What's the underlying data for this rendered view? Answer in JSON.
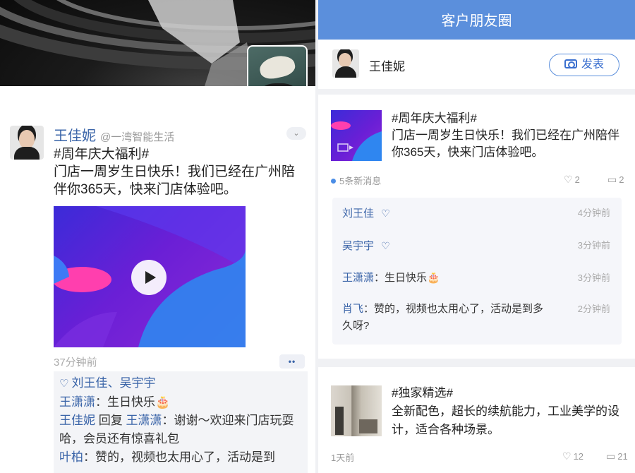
{
  "left_panel": {
    "author": {
      "name": "王佳妮",
      "org": "@一湾智能生活"
    },
    "post": {
      "hashtag": "#周年庆大福利#",
      "text": "门店一周岁生日快乐！我们已经在广州陪伴你365天，快来门店体验吧。",
      "time": "37分钟前",
      "likes": "刘王佳、吴宇宇",
      "comments": [
        {
          "name": "王潇潇",
          "text": "：生日快乐🎂"
        },
        {
          "name": "王佳妮",
          "reply_word": " 回复 ",
          "reply_to": "王潇潇",
          "text": "：谢谢～欢迎来门店玩耍哈，会员还有惊喜礼包"
        },
        {
          "name": "叶柏",
          "text": "：赞的，视频也太用心了，活动是到"
        }
      ]
    }
  },
  "right_panel": {
    "header_title": "客户朋友圈",
    "user": {
      "name": "王佳妮",
      "publish_label": "发表"
    },
    "post1": {
      "hashtag": "#周年庆大福利#",
      "text": "门店一周岁生日快乐！我们已经在广州陪伴你365天，快来门店体验吧。",
      "new_messages": "5条新消息",
      "like_count": "2",
      "comment_count": "2",
      "activity": [
        {
          "name": "刘王佳",
          "text": "",
          "heart": true,
          "time": "4分钟前"
        },
        {
          "name": "吴宇宇",
          "text": "",
          "heart": true,
          "time": "3分钟前"
        },
        {
          "name": "王潇潇",
          "text": "：生日快乐🎂",
          "heart": false,
          "time": "3分钟前"
        },
        {
          "name": "肖飞",
          "text": "：赞的，视频也太用心了，活动是到多久呀?",
          "heart": false,
          "time": "2分钟前"
        }
      ]
    },
    "post2": {
      "hashtag": "#独家精选#",
      "text": "全新配色，超长的续航能力，工业美学的设计，适合各种场景。",
      "time": "1天前",
      "like_count": "12",
      "comment_count": "21"
    }
  },
  "icons": [
    "heart-icon",
    "comment-icon",
    "camera-icon",
    "play-icon",
    "chevron-down-icon",
    "more-icon"
  ],
  "colors": {
    "accent": "#5b8fdc",
    "link_blue": "#3a64a8",
    "unread_dot": "#4a8de6"
  }
}
